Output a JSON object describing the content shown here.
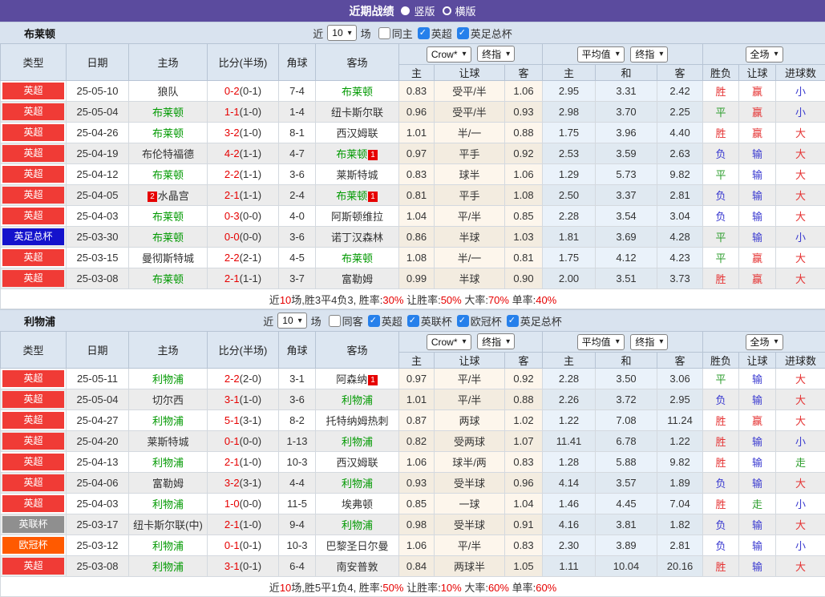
{
  "header": {
    "title": "近期战绩",
    "radio_vertical": "竖版",
    "radio_horizontal": "横版"
  },
  "labels": {
    "near": "近",
    "games": "场"
  },
  "columns": {
    "type": "类型",
    "date": "日期",
    "home": "主场",
    "score": "比分(半场)",
    "corner": "角球",
    "away": "客场",
    "odds_home": "主",
    "odds_handicap": "让球",
    "odds_away": "客",
    "avg_home": "主",
    "avg_draw": "和",
    "avg_away": "客",
    "wl": "胜负",
    "handicap_result": "让球",
    "goals": "进球数"
  },
  "controls": {
    "bookmaker": "Crow*",
    "final": "终指",
    "average": "平均值",
    "avg_final": "终指",
    "scope": "全场"
  },
  "colors": {
    "accent": "#5b4b9e",
    "self_team": "#009900",
    "score_fulltime": "#e60000",
    "summary_highlight": "#e60000",
    "league": {
      "英超": "#f03b36",
      "英足总杯": "#1412cc",
      "英联杯": "#8f8f8f",
      "欧冠杯": "#ff5a00"
    },
    "result": {
      "胜": "#e53333",
      "赢": "#e53333",
      "大": "#e53333",
      "平": "#2e9e2e",
      "走": "#2e9e2e",
      "负": "#3a3ad0",
      "输": "#3a3ad0",
      "小": "#3a3ad0"
    }
  },
  "sections": [
    {
      "team": "布莱顿",
      "near_count": "10",
      "filters": [
        {
          "label": "同主",
          "checked": false
        },
        {
          "label": "英超",
          "checked": true
        },
        {
          "label": "英足总杯",
          "checked": true
        }
      ],
      "rows": [
        {
          "league": "英超",
          "date": "25-05-10",
          "home": {
            "n": "狼队"
          },
          "ft": "0-2",
          "ht": "0-1",
          "corner": "7-4",
          "away": {
            "n": "布莱顿",
            "self": true
          },
          "crow": [
            "0.83",
            "受平/半",
            "1.06"
          ],
          "avg": [
            "2.95",
            "3.31",
            "2.42"
          ],
          "result": [
            "胜",
            "赢",
            "小"
          ]
        },
        {
          "league": "英超",
          "date": "25-05-04",
          "home": {
            "n": "布莱顿",
            "self": true
          },
          "ft": "1-1",
          "ht": "1-0",
          "corner": "1-4",
          "away": {
            "n": "纽卡斯尔联"
          },
          "crow": [
            "0.96",
            "受平/半",
            "0.93"
          ],
          "avg": [
            "2.98",
            "3.70",
            "2.25"
          ],
          "result": [
            "平",
            "赢",
            "小"
          ]
        },
        {
          "league": "英超",
          "date": "25-04-26",
          "home": {
            "n": "布莱顿",
            "self": true
          },
          "ft": "3-2",
          "ht": "1-0",
          "corner": "8-1",
          "away": {
            "n": "西汉姆联"
          },
          "crow": [
            "1.01",
            "半/一",
            "0.88"
          ],
          "avg": [
            "1.75",
            "3.96",
            "4.40"
          ],
          "result": [
            "胜",
            "赢",
            "大"
          ]
        },
        {
          "league": "英超",
          "date": "25-04-19",
          "home": {
            "n": "布伦特福德"
          },
          "ft": "4-2",
          "ht": "1-1",
          "corner": "4-7",
          "away": {
            "n": "布莱顿",
            "self": true,
            "post": "1"
          },
          "crow": [
            "0.97",
            "平手",
            "0.92"
          ],
          "avg": [
            "2.53",
            "3.59",
            "2.63"
          ],
          "result": [
            "负",
            "输",
            "大"
          ]
        },
        {
          "league": "英超",
          "date": "25-04-12",
          "home": {
            "n": "布莱顿",
            "self": true
          },
          "ft": "2-2",
          "ht": "1-1",
          "corner": "3-6",
          "away": {
            "n": "莱斯特城"
          },
          "crow": [
            "0.83",
            "球半",
            "1.06"
          ],
          "avg": [
            "1.29",
            "5.73",
            "9.82"
          ],
          "result": [
            "平",
            "输",
            "大"
          ]
        },
        {
          "league": "英超",
          "date": "25-04-05",
          "home": {
            "n": "水晶宫",
            "pre": "2"
          },
          "ft": "2-1",
          "ht": "1-1",
          "corner": "2-4",
          "away": {
            "n": "布莱顿",
            "self": true,
            "post": "1"
          },
          "crow": [
            "0.81",
            "平手",
            "1.08"
          ],
          "avg": [
            "2.50",
            "3.37",
            "2.81"
          ],
          "result": [
            "负",
            "输",
            "大"
          ]
        },
        {
          "league": "英超",
          "date": "25-04-03",
          "home": {
            "n": "布莱顿",
            "self": true
          },
          "ft": "0-3",
          "ht": "0-0",
          "corner": "4-0",
          "away": {
            "n": "阿斯顿维拉"
          },
          "crow": [
            "1.04",
            "平/半",
            "0.85"
          ],
          "avg": [
            "2.28",
            "3.54",
            "3.04"
          ],
          "result": [
            "负",
            "输",
            "大"
          ]
        },
        {
          "league": "英足总杯",
          "date": "25-03-30",
          "home": {
            "n": "布莱顿",
            "self": true
          },
          "ft": "0-0",
          "ht": "0-0",
          "corner": "3-6",
          "away": {
            "n": "诺丁汉森林"
          },
          "crow": [
            "0.86",
            "半球",
            "1.03"
          ],
          "avg": [
            "1.81",
            "3.69",
            "4.28"
          ],
          "result": [
            "平",
            "输",
            "小"
          ]
        },
        {
          "league": "英超",
          "date": "25-03-15",
          "home": {
            "n": "曼彻斯特城"
          },
          "ft": "2-2",
          "ht": "2-1",
          "corner": "4-5",
          "away": {
            "n": "布莱顿",
            "self": true
          },
          "crow": [
            "1.08",
            "半/一",
            "0.81"
          ],
          "avg": [
            "1.75",
            "4.12",
            "4.23"
          ],
          "result": [
            "平",
            "赢",
            "大"
          ]
        },
        {
          "league": "英超",
          "date": "25-03-08",
          "home": {
            "n": "布莱顿",
            "self": true
          },
          "ft": "2-1",
          "ht": "1-1",
          "corner": "3-7",
          "away": {
            "n": "富勒姆"
          },
          "crow": [
            "0.99",
            "半球",
            "0.90"
          ],
          "avg": [
            "2.00",
            "3.51",
            "3.73"
          ],
          "result": [
            "胜",
            "赢",
            "大"
          ]
        }
      ],
      "summary": [
        [
          "近",
          false
        ],
        [
          "10",
          true
        ],
        [
          "场,胜3平4负3, 胜率:",
          false
        ],
        [
          "30%",
          true
        ],
        [
          " 让胜率:",
          false
        ],
        [
          "50%",
          true
        ],
        [
          " 大率:",
          false
        ],
        [
          "70%",
          true
        ],
        [
          " 单率:",
          false
        ],
        [
          "40%",
          true
        ]
      ]
    },
    {
      "team": "利物浦",
      "near_count": "10",
      "filters": [
        {
          "label": "同客",
          "checked": false
        },
        {
          "label": "英超",
          "checked": true
        },
        {
          "label": "英联杯",
          "checked": true
        },
        {
          "label": "欧冠杯",
          "checked": true
        },
        {
          "label": "英足总杯",
          "checked": true
        }
      ],
      "rows": [
        {
          "league": "英超",
          "date": "25-05-11",
          "home": {
            "n": "利物浦",
            "self": true
          },
          "ft": "2-2",
          "ht": "2-0",
          "corner": "3-1",
          "away": {
            "n": "阿森纳",
            "post": "1"
          },
          "crow": [
            "0.97",
            "平/半",
            "0.92"
          ],
          "avg": [
            "2.28",
            "3.50",
            "3.06"
          ],
          "result": [
            "平",
            "输",
            "大"
          ]
        },
        {
          "league": "英超",
          "date": "25-05-04",
          "home": {
            "n": "切尔西"
          },
          "ft": "3-1",
          "ht": "1-0",
          "corner": "3-6",
          "away": {
            "n": "利物浦",
            "self": true
          },
          "crow": [
            "1.01",
            "平/半",
            "0.88"
          ],
          "avg": [
            "2.26",
            "3.72",
            "2.95"
          ],
          "result": [
            "负",
            "输",
            "大"
          ]
        },
        {
          "league": "英超",
          "date": "25-04-27",
          "home": {
            "n": "利物浦",
            "self": true
          },
          "ft": "5-1",
          "ht": "3-1",
          "corner": "8-2",
          "away": {
            "n": "托特纳姆热刺"
          },
          "crow": [
            "0.87",
            "两球",
            "1.02"
          ],
          "avg": [
            "1.22",
            "7.08",
            "11.24"
          ],
          "result": [
            "胜",
            "赢",
            "大"
          ]
        },
        {
          "league": "英超",
          "date": "25-04-20",
          "home": {
            "n": "莱斯特城"
          },
          "ft": "0-1",
          "ht": "0-0",
          "corner": "1-13",
          "away": {
            "n": "利物浦",
            "self": true
          },
          "crow": [
            "0.82",
            "受两球",
            "1.07"
          ],
          "avg": [
            "11.41",
            "6.78",
            "1.22"
          ],
          "result": [
            "胜",
            "输",
            "小"
          ]
        },
        {
          "league": "英超",
          "date": "25-04-13",
          "home": {
            "n": "利物浦",
            "self": true
          },
          "ft": "2-1",
          "ht": "1-0",
          "corner": "10-3",
          "away": {
            "n": "西汉姆联"
          },
          "crow": [
            "1.06",
            "球半/两",
            "0.83"
          ],
          "avg": [
            "1.28",
            "5.88",
            "9.82"
          ],
          "result": [
            "胜",
            "输",
            "走"
          ]
        },
        {
          "league": "英超",
          "date": "25-04-06",
          "home": {
            "n": "富勒姆"
          },
          "ft": "3-2",
          "ht": "3-1",
          "corner": "4-4",
          "away": {
            "n": "利物浦",
            "self": true
          },
          "crow": [
            "0.93",
            "受半球",
            "0.96"
          ],
          "avg": [
            "4.14",
            "3.57",
            "1.89"
          ],
          "result": [
            "负",
            "输",
            "大"
          ]
        },
        {
          "league": "英超",
          "date": "25-04-03",
          "home": {
            "n": "利物浦",
            "self": true
          },
          "ft": "1-0",
          "ht": "0-0",
          "corner": "11-5",
          "away": {
            "n": "埃弗顿"
          },
          "crow": [
            "0.85",
            "一球",
            "1.04"
          ],
          "avg": [
            "1.46",
            "4.45",
            "7.04"
          ],
          "result": [
            "胜",
            "走",
            "小"
          ]
        },
        {
          "league": "英联杯",
          "date": "25-03-17",
          "home": {
            "n": "纽卡斯尔联(中)"
          },
          "ft": "2-1",
          "ht": "1-0",
          "corner": "9-4",
          "away": {
            "n": "利物浦",
            "self": true
          },
          "crow": [
            "0.98",
            "受半球",
            "0.91"
          ],
          "avg": [
            "4.16",
            "3.81",
            "1.82"
          ],
          "result": [
            "负",
            "输",
            "大"
          ]
        },
        {
          "league": "欧冠杯",
          "date": "25-03-12",
          "home": {
            "n": "利物浦",
            "self": true
          },
          "ft": "0-1",
          "ht": "0-1",
          "corner": "10-3",
          "away": {
            "n": "巴黎圣日尔曼"
          },
          "crow": [
            "1.06",
            "平/半",
            "0.83"
          ],
          "avg": [
            "2.30",
            "3.89",
            "2.81"
          ],
          "result": [
            "负",
            "输",
            "小"
          ]
        },
        {
          "league": "英超",
          "date": "25-03-08",
          "home": {
            "n": "利物浦",
            "self": true
          },
          "ft": "3-1",
          "ht": "0-1",
          "corner": "6-4",
          "away": {
            "n": "南安普敦"
          },
          "crow": [
            "0.84",
            "两球半",
            "1.05"
          ],
          "avg": [
            "1.11",
            "10.04",
            "20.16"
          ],
          "result": [
            "胜",
            "输",
            "大"
          ]
        }
      ],
      "summary": [
        [
          "近",
          false
        ],
        [
          "10",
          true
        ],
        [
          "场,胜5平1负4, 胜率:",
          false
        ],
        [
          "50%",
          true
        ],
        [
          " 让胜率:",
          false
        ],
        [
          "10%",
          true
        ],
        [
          " 大率:",
          false
        ],
        [
          "60%",
          true
        ],
        [
          " 单率:",
          false
        ],
        [
          "60%",
          true
        ]
      ]
    }
  ]
}
